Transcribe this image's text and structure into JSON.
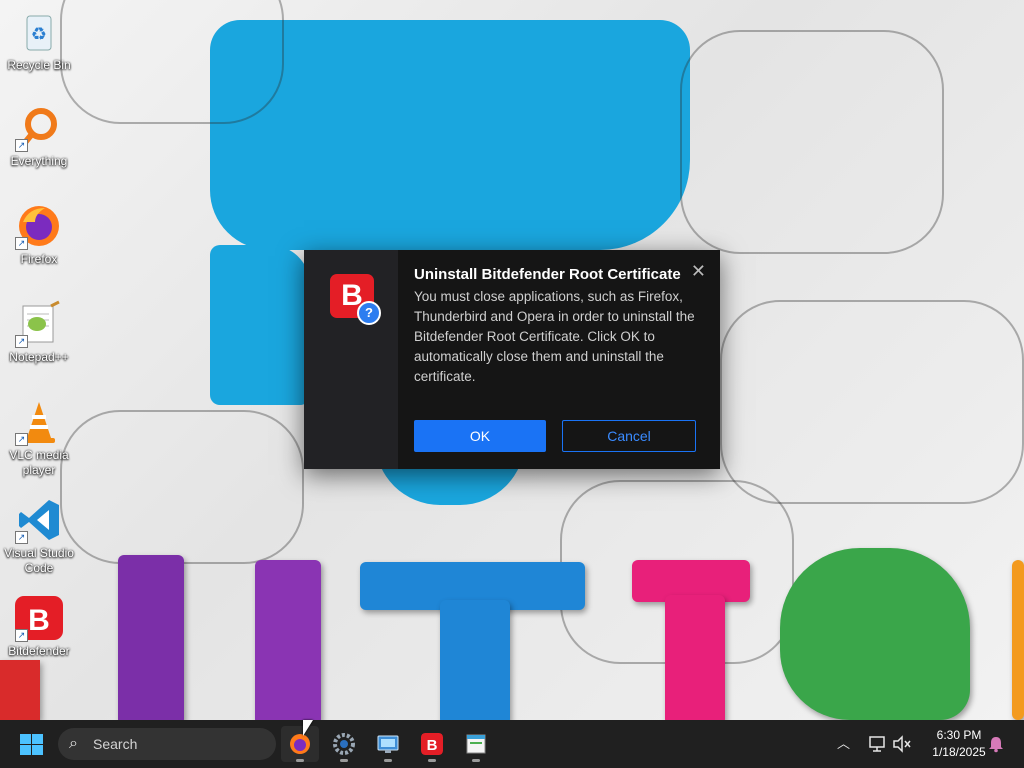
{
  "desktop": {
    "icons": [
      {
        "label": "Recycle Bin",
        "icon": "recycle-bin-icon"
      },
      {
        "label": "Everything",
        "icon": "search-app-icon"
      },
      {
        "label": "Firefox",
        "icon": "firefox-icon"
      },
      {
        "label": "Notepad++",
        "icon": "notepad-plus-plus-icon"
      },
      {
        "label": "VLC media player",
        "icon": "vlc-icon"
      },
      {
        "label": "Visual Studio Code",
        "icon": "vscode-icon"
      },
      {
        "label": "Bitdefender",
        "icon": "bitdefender-icon"
      }
    ]
  },
  "dialog": {
    "title": "Uninstall Bitdefender Root Certificate",
    "message": "You must close applications, such as Firefox, Thunderbird and Opera in order to uninstall the Bitdefender Root Certificate. Click OK to automatically close them and uninstall the certificate.",
    "logo_letter": "B",
    "badge": "?",
    "close_glyph": "✕",
    "ok_label": "OK",
    "cancel_label": "Cancel"
  },
  "taskbar": {
    "search_placeholder": "Search",
    "apps": [
      "firefox-icon",
      "settings-icon",
      "remote-desktop-icon",
      "bitdefender-icon",
      "notepad-icon"
    ],
    "time": "6:30 PM",
    "date": "1/18/2025"
  },
  "colors": {
    "accent": "#1a73f5",
    "bitdefender_red": "#e41e26",
    "taskbar": "#202020",
    "dialog_bg": "#151515"
  }
}
